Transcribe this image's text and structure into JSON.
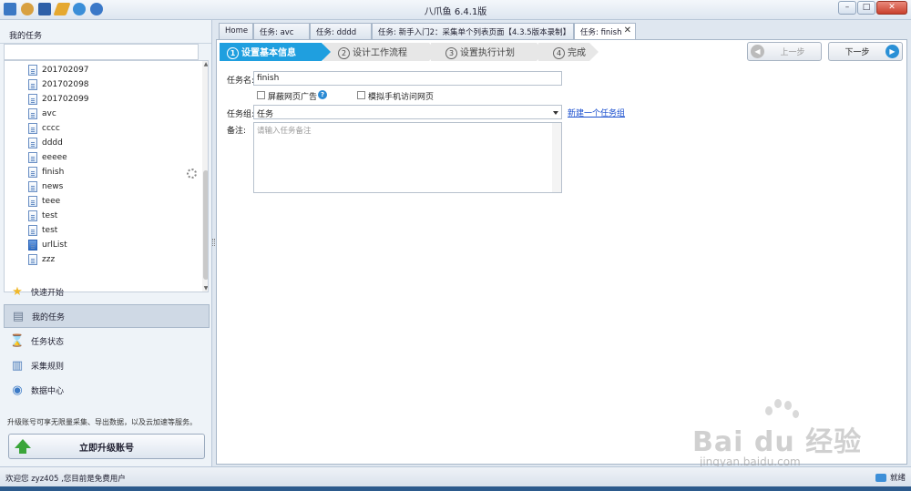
{
  "app": {
    "title": "八爪鱼 6.4.1版",
    "window_buttons": [
      "–",
      "□",
      "✕"
    ]
  },
  "left_panel": {
    "header": "我的任务",
    "tree_items": [
      "201702097",
      "201702098",
      "201702099",
      "avc",
      "cccc",
      "dddd",
      "eeeee",
      "finish",
      "news",
      "teee",
      "test",
      "test",
      "urlList",
      "zzz"
    ],
    "nav": [
      {
        "label": "快速开始",
        "icon": "star-icon"
      },
      {
        "label": "我的任务",
        "icon": "clipboard-icon"
      },
      {
        "label": "任务状态",
        "icon": "hourglass-icon"
      },
      {
        "label": "采集规则",
        "icon": "document-icon"
      },
      {
        "label": "数据中心",
        "icon": "database-icon"
      }
    ],
    "promo": "升级账号可享无限量采集、导出数据，以及云加速等服务。",
    "upgrade_label": "立即升级账号"
  },
  "tabs": [
    {
      "label": "Home"
    },
    {
      "label": "任务: avc"
    },
    {
      "label": "任务: dddd"
    },
    {
      "label": "任务: 新手入门2：采集单个列表页面【4.3.5版本录制】"
    },
    {
      "label": "任务: finish",
      "close": "✕"
    }
  ],
  "wizard": {
    "steps": [
      {
        "num": "1",
        "label": "设置基本信息"
      },
      {
        "num": "2",
        "label": "设计工作流程"
      },
      {
        "num": "3",
        "label": "设置执行计划"
      },
      {
        "num": "4",
        "label": "完成"
      }
    ],
    "prev_label": "上一步",
    "next_label": "下一步"
  },
  "form": {
    "task_name_label": "任务名:",
    "task_name_value": "finish",
    "block_ads_label": "屏蔽网页广告",
    "mobile_label": "模拟手机访问网页",
    "group_label": "任务组:",
    "group_value": "任务",
    "new_group_link": "新建一个任务组",
    "remark_label": "备注:",
    "remark_placeholder": "请输入任务备注"
  },
  "statusbar": {
    "message": "欢迎您  zyz405 ,您目前是免费用户",
    "ready": "就绪"
  },
  "watermark": {
    "brand": "Bai du 经验",
    "url": "jingyan.baidu.com"
  },
  "colors": {
    "accent": "#1f9fdf",
    "link": "#1a4fcf",
    "upgrade_arrow": "#3aa53a"
  }
}
